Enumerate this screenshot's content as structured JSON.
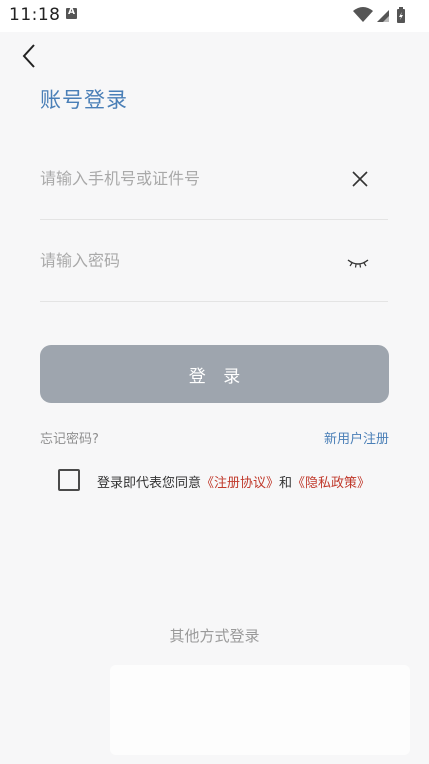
{
  "status_bar": {
    "time": "11:18",
    "app_icon_letter": "A"
  },
  "header": {
    "title": "账号登录"
  },
  "form": {
    "account_placeholder": "请输入手机号或证件号",
    "account_value": "",
    "password_placeholder": "请输入密码",
    "password_value": ""
  },
  "login_button": {
    "label": "登 录"
  },
  "links": {
    "forgot_password": "忘记密码?",
    "register": "新用户注册"
  },
  "agreement": {
    "prefix": "登录即代表您同意",
    "terms": "《注册协议》",
    "conjunction": "和",
    "privacy": "《隐私政策》",
    "checked": false
  },
  "other_login": {
    "label": "其他方式登录"
  },
  "colors": {
    "accent": "#4a7fb7",
    "button_disabled": "#9ea5ae",
    "policy_link": "#c0392b",
    "background": "#f7f7f8"
  },
  "icons": {
    "back": "back-arrow-icon",
    "clear": "close-icon",
    "password_visibility": "eye-closed-icon",
    "wifi": "wifi-icon",
    "signal": "signal-icon",
    "battery": "battery-icon"
  }
}
